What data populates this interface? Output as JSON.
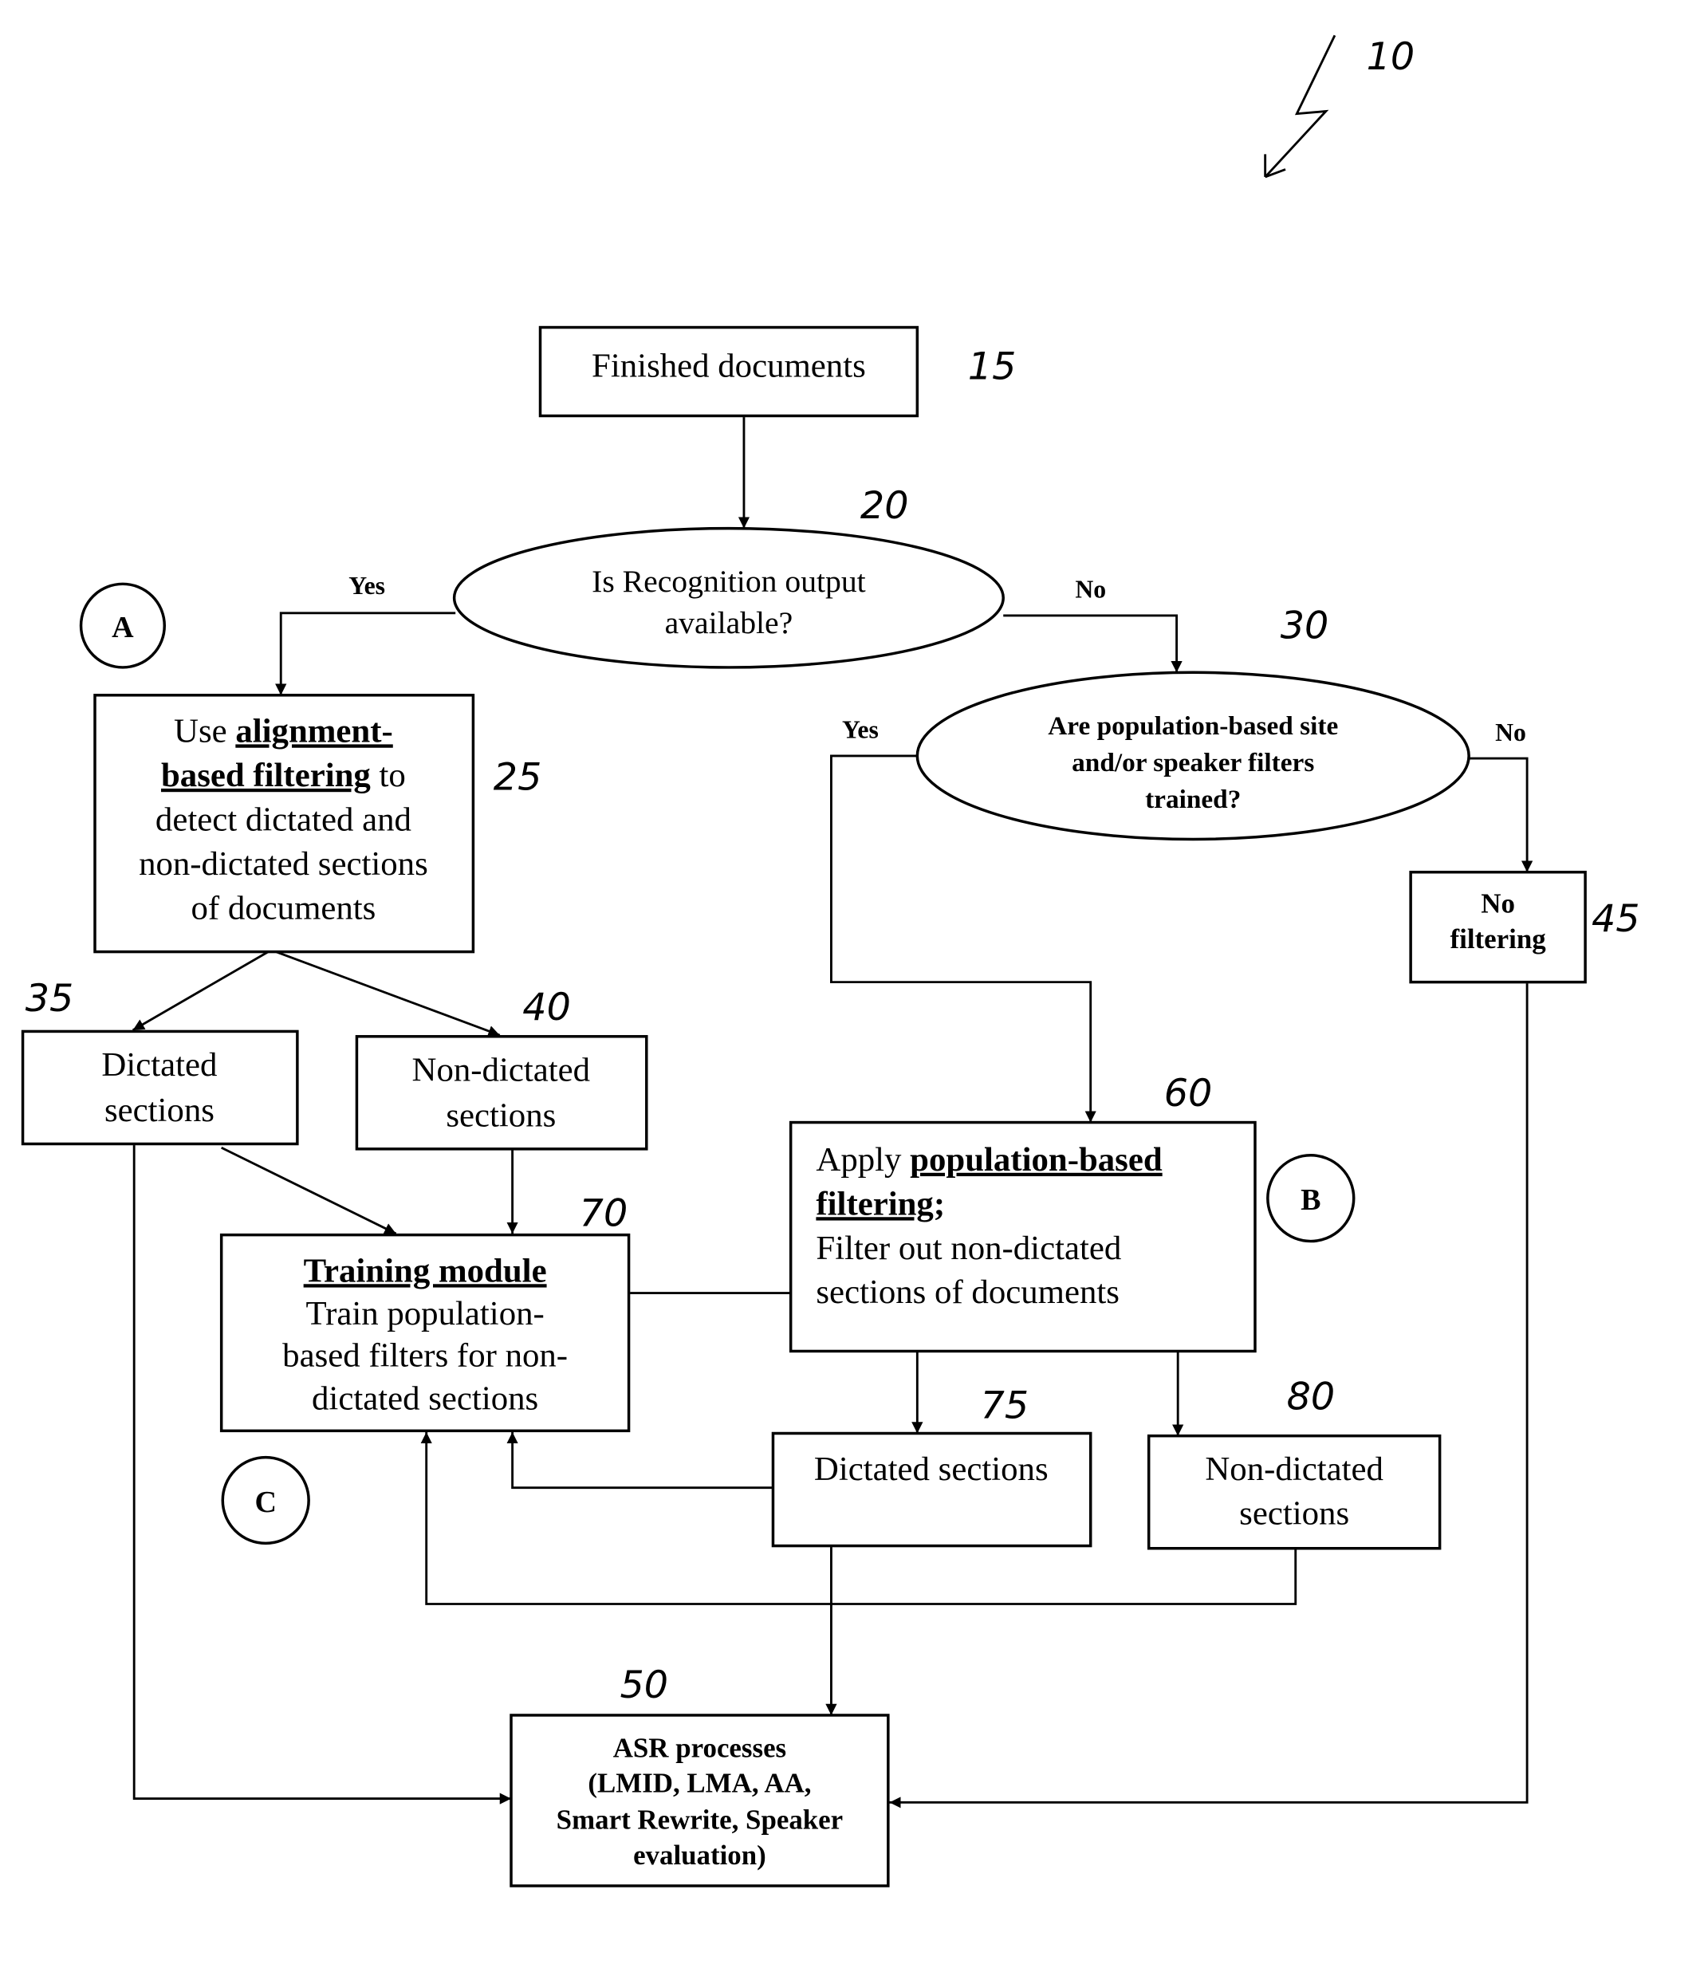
{
  "figure": {
    "ref": "10",
    "nodes": {
      "n15": {
        "ref": "15",
        "lines": [
          "Finished documents"
        ]
      },
      "n20": {
        "ref": "20",
        "lines": [
          "Is Recognition output",
          "available?"
        ]
      },
      "n30": {
        "ref": "30",
        "lines": [
          "Are population-based site",
          "and/or speaker filters",
          "trained?"
        ]
      },
      "n25": {
        "ref": "25",
        "pre": "Use ",
        "u1": "alignment-",
        "u2": "based filtering",
        "post": " to",
        "lines": [
          "detect dictated and",
          "non-dictated sections",
          "of documents"
        ]
      },
      "n35": {
        "ref": "35",
        "lines": [
          "Dictated",
          "sections"
        ]
      },
      "n40": {
        "ref": "40",
        "lines": [
          "Non-dictated",
          "sections"
        ]
      },
      "n45": {
        "ref": "45",
        "lines": [
          "No",
          "filtering"
        ]
      },
      "n60": {
        "ref": "60",
        "pre": "Apply ",
        "u1": "population-based",
        "u2": "filtering",
        "post": ";",
        "lines": [
          "Filter out non-dictated",
          "sections of documents"
        ]
      },
      "n70": {
        "ref": "70",
        "title": "Training module",
        "lines": [
          "Train population-",
          "based filters for non-",
          "dictated sections"
        ]
      },
      "n75": {
        "ref": "75",
        "lines": [
          "Dictated sections"
        ]
      },
      "n80": {
        "ref": "80",
        "lines": [
          "Non-dictated",
          "sections"
        ]
      },
      "n50": {
        "ref": "50",
        "lines": [
          "ASR processes",
          "(LMID, LMA, AA,",
          "Smart Rewrite, Speaker",
          "evaluation)"
        ]
      }
    },
    "edge_labels": {
      "yes1": "Yes",
      "no1": "No",
      "yes2": "Yes",
      "no2": "No"
    },
    "markers": {
      "a": "A",
      "b": "B",
      "c": "C"
    }
  }
}
